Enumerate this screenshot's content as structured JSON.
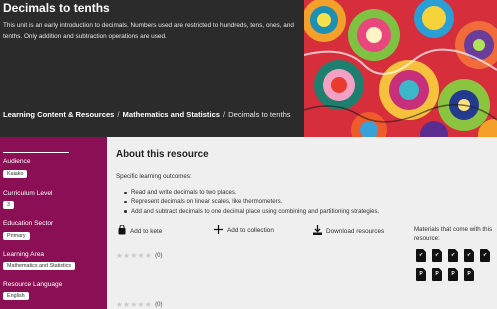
{
  "hero": {
    "title": "Decimals to tenths",
    "description": "This unit is an early introduction to decimals. Numbers used are restricted to hundreds, tens, ones, and tenths. Only addition and subtraction operations are used."
  },
  "breadcrumb": {
    "items": [
      "Learning Content & Resources",
      "Mathematics and Statistics",
      "Decimals to tenths"
    ],
    "separator": "/"
  },
  "sidebar": {
    "audience_label": "Audience",
    "audience_value": "Kaiako",
    "curriculum_label": "Curriculum Level",
    "curriculum_value": "3",
    "sector_label": "Education Sector",
    "sector_value": "Primary",
    "area_label": "Learning Area",
    "area_value": "Mathematics and Statistics",
    "language_label": "Resource Language",
    "language_value": "English"
  },
  "main": {
    "title": "About this resource",
    "outcomes_intro": "Specific learning outcomes:",
    "outcomes": [
      "Read and write decimals to two places.",
      "Represent decimals on linear scales, like thermometers.",
      "Add and subtract decimals to one decimal place using combining and partitioning strategies."
    ],
    "actions": {
      "add_to_kete": "Add to kete",
      "add_to_collection": "Add to collection",
      "download": "Download resources"
    },
    "rating_count_1": "(0)",
    "rating_count_2": "(0)",
    "materials_label": "Materials that come with this resource:"
  },
  "materials": [
    {
      "icon": "pdf-icon"
    },
    {
      "icon": "pdf-icon"
    },
    {
      "icon": "pdf-icon"
    },
    {
      "icon": "pdf-icon"
    },
    {
      "icon": "pdf-icon"
    },
    {
      "icon": "powerpoint-icon"
    },
    {
      "icon": "powerpoint-icon"
    },
    {
      "icon": "powerpoint-icon"
    },
    {
      "icon": "powerpoint-icon"
    }
  ],
  "colors": {
    "hero_bg": "#2b2b2b",
    "sidebar_bg": "#8a0f54",
    "main_bg": "#f0efef"
  }
}
